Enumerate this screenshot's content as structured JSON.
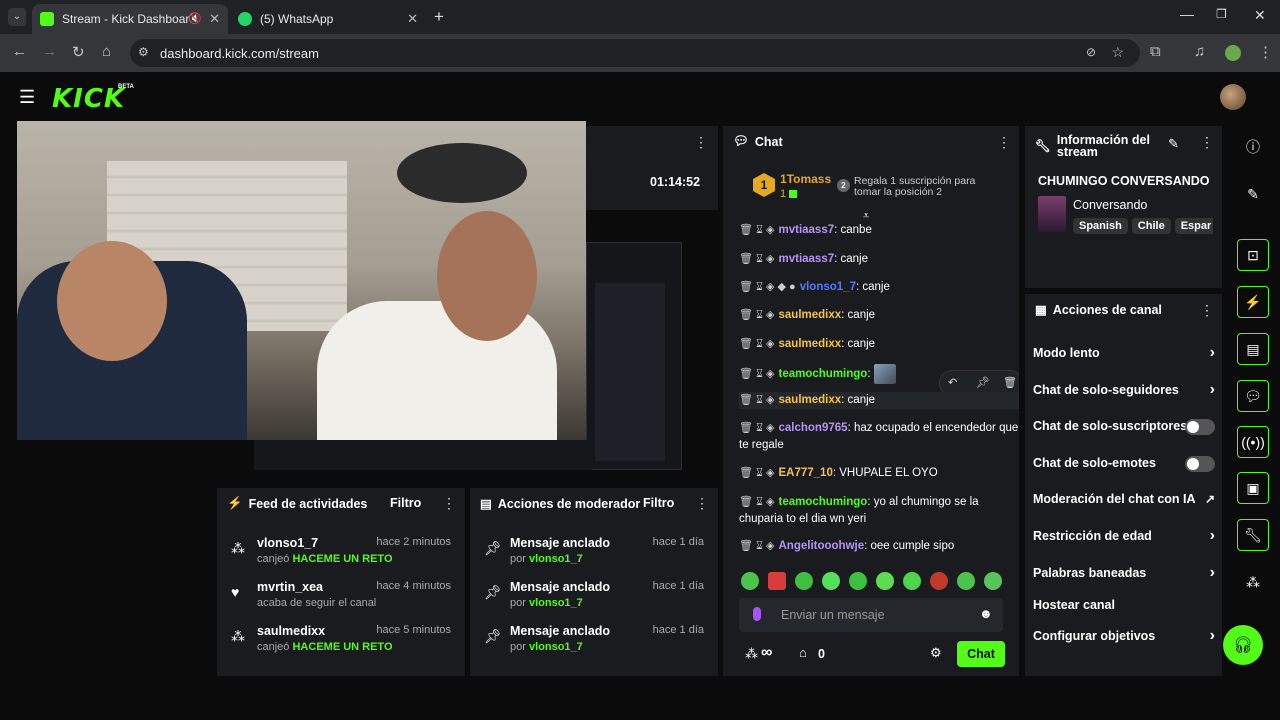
{
  "browser": {
    "tabs": [
      {
        "title": "Stream - Kick Dashboard"
      },
      {
        "title": "(5) WhatsApp"
      }
    ],
    "url": "dashboard.kick.com/stream"
  },
  "brand": {
    "logo": "KICK",
    "beta": "BETA",
    "accent": "#53fc18"
  },
  "stream": {
    "timer": "01:14:52"
  },
  "feed": {
    "title": "Feed de actividades",
    "filter": "Filtro",
    "items": [
      {
        "icon": "kicks-icon",
        "user": "vlonso1_7",
        "time": "hace 2 minutos",
        "action": "canjeó",
        "highlight": "HACEME UN RETO"
      },
      {
        "icon": "heart-icon",
        "user": "mvrtin_xea",
        "time": "hace 4 minutos",
        "action": "acaba de seguir el canal",
        "highlight": ""
      },
      {
        "icon": "kicks-icon",
        "user": "saulmedixx",
        "time": "hace 5 minutos",
        "action": "canjeó",
        "highlight": "HACEME UN RETO"
      }
    ]
  },
  "modactions": {
    "title": "Acciones de moderador",
    "filter": "Filtro",
    "items": [
      {
        "title": "Mensaje anclado",
        "time": "hace 1 día",
        "by": "por",
        "user": "vlonso1_7"
      },
      {
        "title": "Mensaje anclado",
        "time": "hace 1 día",
        "by": "por",
        "user": "vlonso1_7"
      },
      {
        "title": "Mensaje anclado",
        "time": "hace 1 día",
        "by": "por",
        "user": "vlonso1_7"
      }
    ]
  },
  "chat": {
    "title": "Chat",
    "leader": {
      "rank": "1",
      "name": "1Tomass",
      "count": "1",
      "prompt_rank": "2",
      "prompt": "Regala 1 suscripción para tomar la posición 2"
    },
    "messages": [
      {
        "user": "mvtiaass7",
        "color": "#b794f4",
        "text": "canbe"
      },
      {
        "user": "mvtiaass7",
        "color": "#b794f4",
        "text": "canje"
      },
      {
        "user": "vlonso1_7",
        "color": "#4d7cfe",
        "text": "canje"
      },
      {
        "user": "saulmedixx",
        "color": "#f6c343",
        "text": "canje"
      },
      {
        "user": "saulmedixx",
        "color": "#f6c343",
        "text": "canje"
      },
      {
        "user": "teamochumingo",
        "color": "#53fc18",
        "text": ""
      },
      {
        "user": "saulmedixx",
        "color": "#f6c343",
        "text": "canje"
      },
      {
        "user": "calchon9765",
        "color": "#b794f4",
        "text": "haz ocupado el encendedor que te regale"
      },
      {
        "user": "EA777_10",
        "color": "#f6c343",
        "text": "VHUPALE EL OYO"
      },
      {
        "user": "teamochumingo",
        "color": "#53fc18",
        "text": "yo al chumingo se la chuparia to el dia wn yeri"
      },
      {
        "user": "Angelitooohwje",
        "color": "#b794f4",
        "text": "oee cumple sipo"
      }
    ],
    "input_placeholder": "Enviar un mensaje",
    "infinity": "∞",
    "points": "0",
    "send": "Chat"
  },
  "info": {
    "title": "Información del stream",
    "stream_title": "CHUMINGO CONVERSANDO",
    "category": "Conversando",
    "tags": [
      "Spanish",
      "Chile",
      "Espar"
    ]
  },
  "channel": {
    "title": "Acciones de canal",
    "rows": [
      {
        "label": "Modo lento",
        "control": "chevron"
      },
      {
        "label": "Chat de solo-seguidores",
        "control": "chevron"
      },
      {
        "label": "Chat de solo-suscriptores",
        "control": "toggle"
      },
      {
        "label": "Chat de solo-emotes",
        "control": "toggle"
      },
      {
        "label": "Moderación del chat con IA",
        "control": "external"
      },
      {
        "label": "Restricción de edad",
        "control": "chevron"
      },
      {
        "label": "Palabras baneadas",
        "control": "chevron"
      },
      {
        "label": "Hostear canal",
        "control": "none"
      },
      {
        "label": "Configurar objetivos",
        "control": "chevron"
      }
    ]
  }
}
